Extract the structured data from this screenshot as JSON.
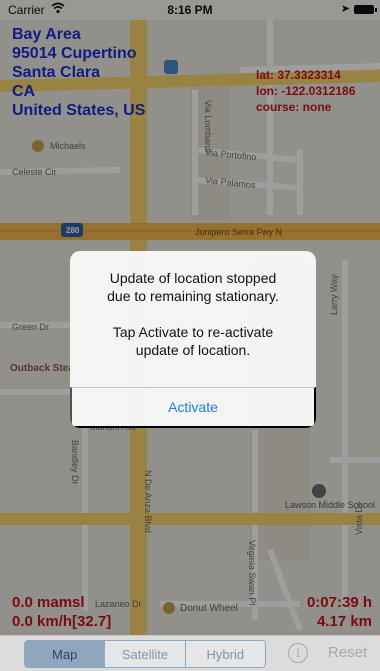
{
  "status_bar": {
    "carrier": "Carrier",
    "time": "8:16 PM"
  },
  "address": {
    "line1": "Bay Area",
    "line2": "95014 Cupertino",
    "line3": "Santa Clara",
    "line4": "CA",
    "line5": "United States, US"
  },
  "coords": {
    "lat": "lat:  37.3323314",
    "lon": "lon: -122.0312186",
    "course": "course: none"
  },
  "map": {
    "labels": {
      "michaels": "Michaels",
      "celeste": "Celeste Cir",
      "lombardi": "Via Lombardi",
      "portofino": "Via Portofino",
      "palamos": "Via Palamos",
      "highway_shield": "280",
      "junipero": "Junipero Serra Fwy N",
      "green_dr": "Green Dr",
      "outback": "Outback Stea",
      "larry_way": "Larry Way",
      "mariani": "Mariani Ave",
      "bandley": "Bandley Dr",
      "de_anza": "N De Anza Blvd",
      "swan_pl": "Virginia Swan Pl",
      "lawson": "Lawson Middle School",
      "vista": "Vista Dr",
      "donut": "Donut Wheel",
      "lazaneo": "Lazaneo Dr"
    }
  },
  "readouts": {
    "altitude": "0.0 mamsl",
    "speed": "0.0 km/h[32.7]",
    "elapsed": "0:07:39 h",
    "distance": "4.17 km"
  },
  "alert": {
    "line1": "Update of location stopped",
    "line2": "due to remaining stationary.",
    "line3": "Tap Activate to re-activate",
    "line4": "update of location.",
    "button": "Activate"
  },
  "toolbar": {
    "map": "Map",
    "satellite": "Satellite",
    "hybrid": "Hybrid",
    "info": "i",
    "reset": "Reset"
  }
}
